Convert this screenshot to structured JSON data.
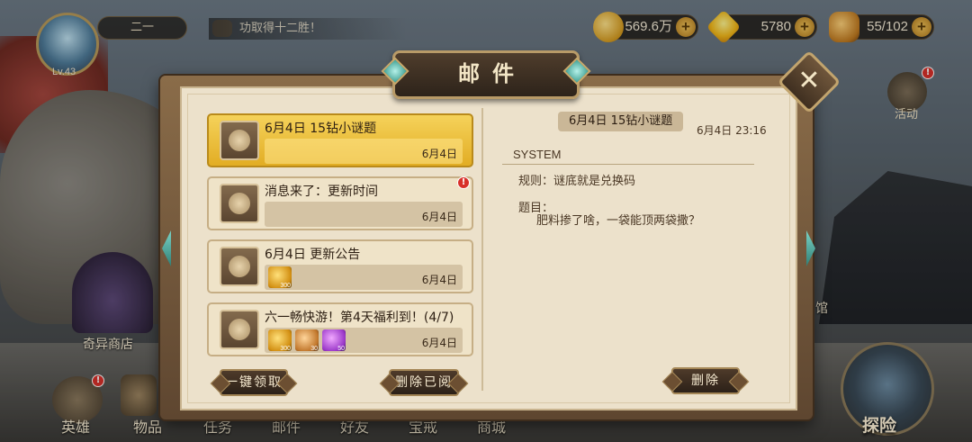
{
  "player": {
    "level": "Lv.43",
    "name": "二一"
  },
  "chat": {
    "message": "功取得十二胜！"
  },
  "resources": {
    "gold": {
      "value": "569.6万",
      "icon": "gold-coin-icon",
      "plus": "+"
    },
    "gems": {
      "value": "5780",
      "icon": "diamond-icon",
      "plus": "+"
    },
    "stamina": {
      "value": "55/102",
      "icon": "meat-icon",
      "plus": "+"
    }
  },
  "side": {
    "activity": "活动",
    "shop": "奇异商店",
    "hall": "馆"
  },
  "bottom_nav": [
    "英雄",
    "物品",
    "任务",
    "邮件",
    "好友",
    "宝戒",
    "商城"
  ],
  "explore": "探险",
  "mail": {
    "title": "邮件",
    "close": "✕",
    "list": [
      {
        "title": "6月4日 15钻小谜题",
        "date": "6月4日",
        "selected": true,
        "unread_badge": ""
      },
      {
        "title": "消息来了：更新时间",
        "date": "6月4日",
        "selected": false,
        "unread_badge": "!"
      },
      {
        "title": "6月4日 更新公告",
        "date": "6月4日",
        "selected": false,
        "unread_badge": "",
        "attachments": [
          {
            "type": "gem",
            "count": "300"
          }
        ]
      },
      {
        "title": "六一畅快游！第4天福利到！(4/7)",
        "date": "6月4日",
        "selected": false,
        "unread_badge": "",
        "attachments": [
          {
            "type": "gem",
            "count": "300"
          },
          {
            "type": "bone",
            "count": "30"
          },
          {
            "type": "potion",
            "count": "50"
          }
        ]
      }
    ],
    "buttons": {
      "claim_all": "一键领取",
      "delete_read": "删除已阅",
      "delete": "删除"
    },
    "detail": {
      "title": "6月4日 15钻小谜题",
      "date": "6月4日 23:16",
      "sender": "SYSTEM",
      "lines": [
        "规则：谜底就是兑换码",
        "题目：",
        "肥料掺了啥，一袋能顶两袋撒？"
      ]
    }
  }
}
